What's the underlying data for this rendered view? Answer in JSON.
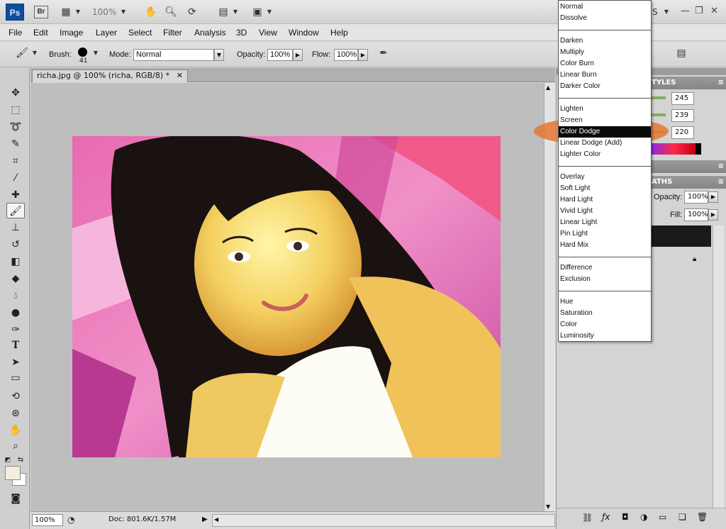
{
  "appbar": {
    "logo": "Ps",
    "bridge": "Br",
    "zoom": "100%",
    "workspace_fragment": "S",
    "controls": {
      "minimize": "—",
      "restore": "❐",
      "close": "✕"
    }
  },
  "menu": [
    "File",
    "Edit",
    "Image",
    "Layer",
    "Select",
    "Filter",
    "Analysis",
    "3D",
    "View",
    "Window",
    "Help"
  ],
  "options": {
    "brush_label": "Brush:",
    "brush_size": "41",
    "mode_label": "Mode:",
    "mode_value": "Normal",
    "opacity_label": "Opacity:",
    "opacity_value": "100%",
    "flow_label": "Flow:",
    "flow_value": "100%"
  },
  "document": {
    "tab_title": "richa.jpg @ 100% (richa, RGB/8) *",
    "tab_close": "✕",
    "zoom": "100%",
    "doc_info": "Doc: 801.6K/1.57M"
  },
  "panels": {
    "styles_header_fragment": "TYLES",
    "color_values": [
      "245",
      "239",
      "220"
    ],
    "layers_header_fragment": "ATHS",
    "opacity_label": "Opacity:",
    "opacity_value": "100%",
    "fill_label": "Fill:",
    "fill_value": "100%"
  },
  "blend_modes": {
    "groups": [
      [
        "Normal",
        "Dissolve"
      ],
      [
        "Darken",
        "Multiply",
        "Color Burn",
        "Linear Burn",
        "Darker Color"
      ],
      [
        "Lighten",
        "Screen",
        "Color Dodge",
        "Linear Dodge (Add)",
        "Lighter Color"
      ],
      [
        "Overlay",
        "Soft Light",
        "Hard Light",
        "Vivid Light",
        "Linear Light",
        "Pin Light",
        "Hard Mix"
      ],
      [
        "Difference",
        "Exclusion"
      ],
      [
        "Hue",
        "Saturation",
        "Color",
        "Luminosity"
      ]
    ],
    "selected": "Color Dodge"
  },
  "colors": {
    "foreground": "#f3eede",
    "background": "#ffffff",
    "annotation": "#e07430"
  }
}
